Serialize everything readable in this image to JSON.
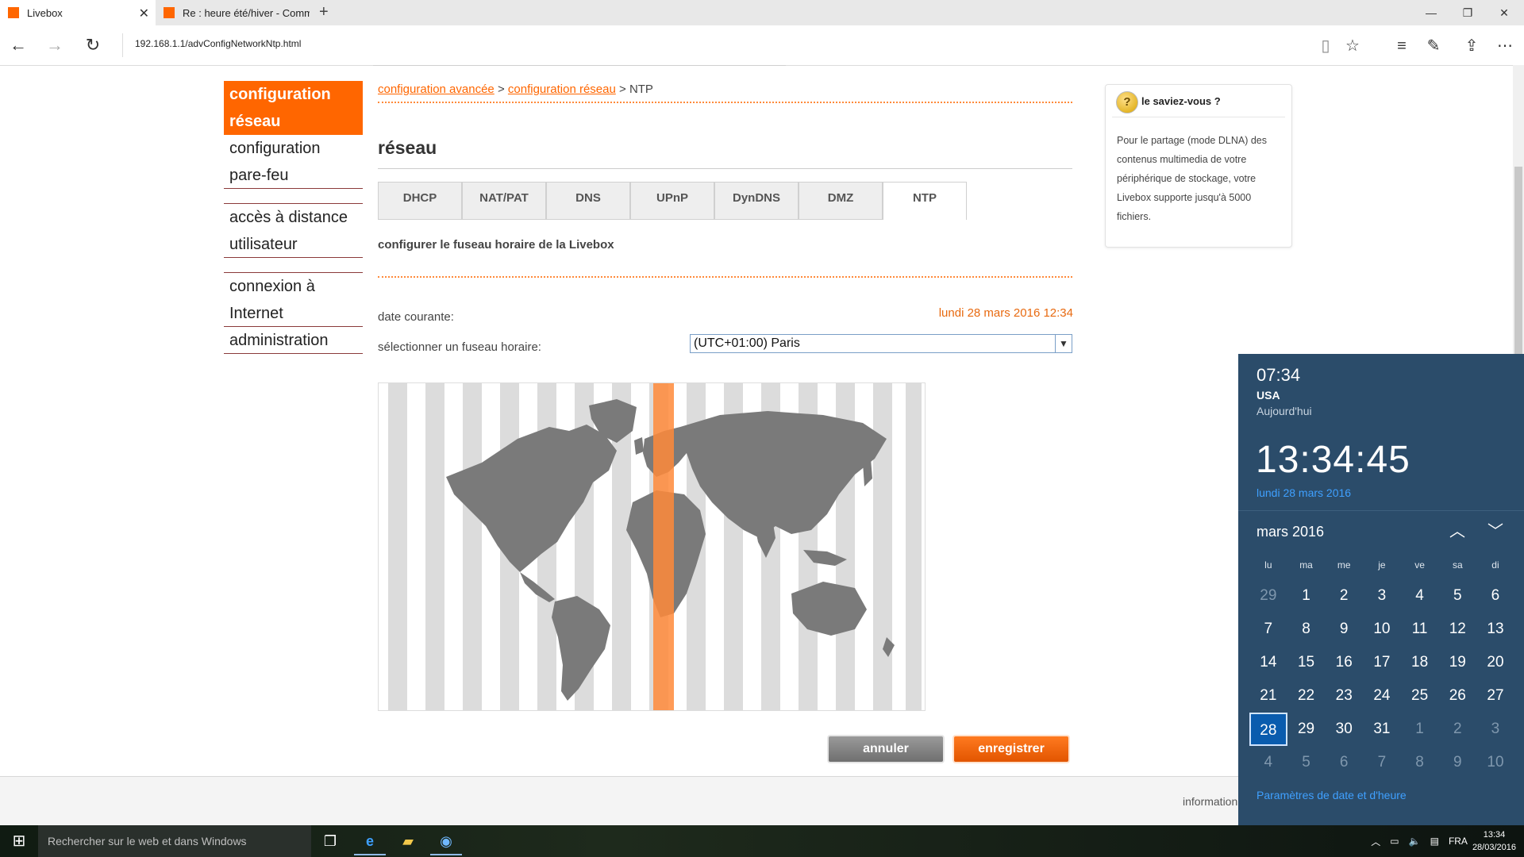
{
  "browser": {
    "tabs": [
      {
        "title": "Livebox",
        "active": true
      },
      {
        "title": "Re : heure été/hiver - Comm",
        "active": false
      }
    ],
    "url": "192.168.1.1/advConfigNetworkNtp.html",
    "new_tab": "+",
    "window_controls": {
      "minimize": "—",
      "maximize": "❐",
      "close": "✕"
    }
  },
  "nav": {
    "items": [
      {
        "label": "configuration réseau",
        "active": true
      },
      {
        "label": "configuration pare-feu"
      },
      {
        "label": "accès à distance utilisateur"
      },
      {
        "label": "connexion à Internet"
      },
      {
        "label": "administration"
      }
    ]
  },
  "breadcrumb": {
    "link1": "configuration avancée",
    "sep": " > ",
    "link2": "configuration réseau",
    "current": "NTP"
  },
  "page_title": "réseau",
  "tabs": [
    "DHCP",
    "NAT/PAT",
    "DNS",
    "UPnP",
    "DynDNS",
    "DMZ",
    "NTP"
  ],
  "active_tab": "NTP",
  "section_title": "configurer le fuseau horaire de la Livebox",
  "current_date_label": "date courante:",
  "current_date_value": "lundi 28 mars 2016 12:34",
  "timezone_label": "sélectionner un fuseau horaire:",
  "timezone_value": "(UTC+01:00) Paris",
  "buttons": {
    "cancel": "annuler",
    "save": "enregistrer"
  },
  "footer_text": "information",
  "tip": {
    "title": "le saviez-vous ?",
    "text": "Pour le partage (mode DLNA) des contenus multimedia de votre périphérique de stockage, votre Livebox supporte jusqu'à 5000 fichiers."
  },
  "clock_flyout": {
    "small_time": "07:34",
    "location": "USA",
    "today": "Aujourd'hui",
    "big_time": "13:34:45",
    "date": "lundi 28 mars 2016",
    "month": "mars 2016",
    "weekdays": [
      "lu",
      "ma",
      "me",
      "je",
      "ve",
      "sa",
      "di"
    ],
    "weeks": [
      [
        "29",
        "1",
        "2",
        "3",
        "4",
        "5",
        "6"
      ],
      [
        "7",
        "8",
        "9",
        "10",
        "11",
        "12",
        "13"
      ],
      [
        "14",
        "15",
        "16",
        "17",
        "18",
        "19",
        "20"
      ],
      [
        "21",
        "22",
        "23",
        "24",
        "25",
        "26",
        "27"
      ],
      [
        "28",
        "29",
        "30",
        "31",
        "1",
        "2",
        "3"
      ],
      [
        "4",
        "5",
        "6",
        "7",
        "8",
        "9",
        "10"
      ]
    ],
    "selected_day": "28",
    "settings_link": "Paramètres de date et d'heure"
  },
  "taskbar": {
    "search_placeholder": "Rechercher sur le web et dans Windows",
    "language": "FRA",
    "time": "13:34",
    "date": "28/03/2016"
  },
  "colors": {
    "accent": "#ff6600",
    "flyout_bg": "#2b4c6a",
    "link_blue": "#3fa0ff"
  }
}
